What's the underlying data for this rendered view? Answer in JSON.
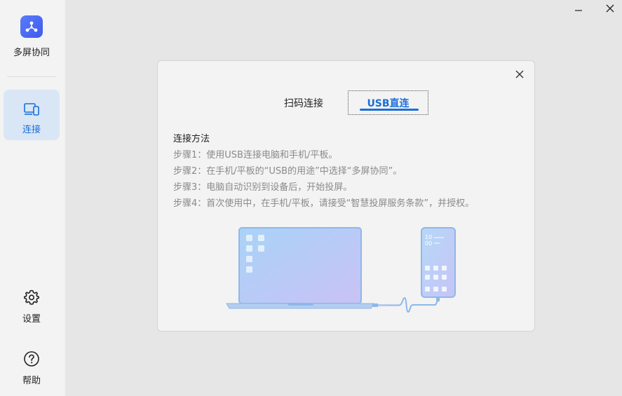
{
  "app": {
    "name": "多屏协同"
  },
  "sidebar": {
    "items": [
      {
        "label": "连接",
        "icon": "devices-icon",
        "active": true
      },
      {
        "label": "设置",
        "icon": "gear-icon",
        "active": false
      },
      {
        "label": "帮助",
        "icon": "help-icon",
        "active": false
      }
    ]
  },
  "dialog": {
    "tabs": [
      {
        "label": "扫码连接",
        "active": false
      },
      {
        "label": "USB直连",
        "active": true
      }
    ],
    "method_title": "连接方法",
    "steps": [
      "步骤1：使用USB连接电脑和手机/平板。",
      "步骤2：在手机/平板的“USB的用途”中选择“多屏协同”。",
      "步骤3：电脑自动识别到设备后，开始投屏。",
      "步骤4：首次使用中，在手机/平板，请接受“智慧投屏服务条款”，并授权。"
    ],
    "phone_clock": [
      "10",
      "00"
    ]
  },
  "colors": {
    "accent": "#1a6ed8",
    "active_nav_bg": "#d9e6f5",
    "sidebar_bg": "#f3f3f3",
    "content_bg": "#e6e6e6"
  }
}
